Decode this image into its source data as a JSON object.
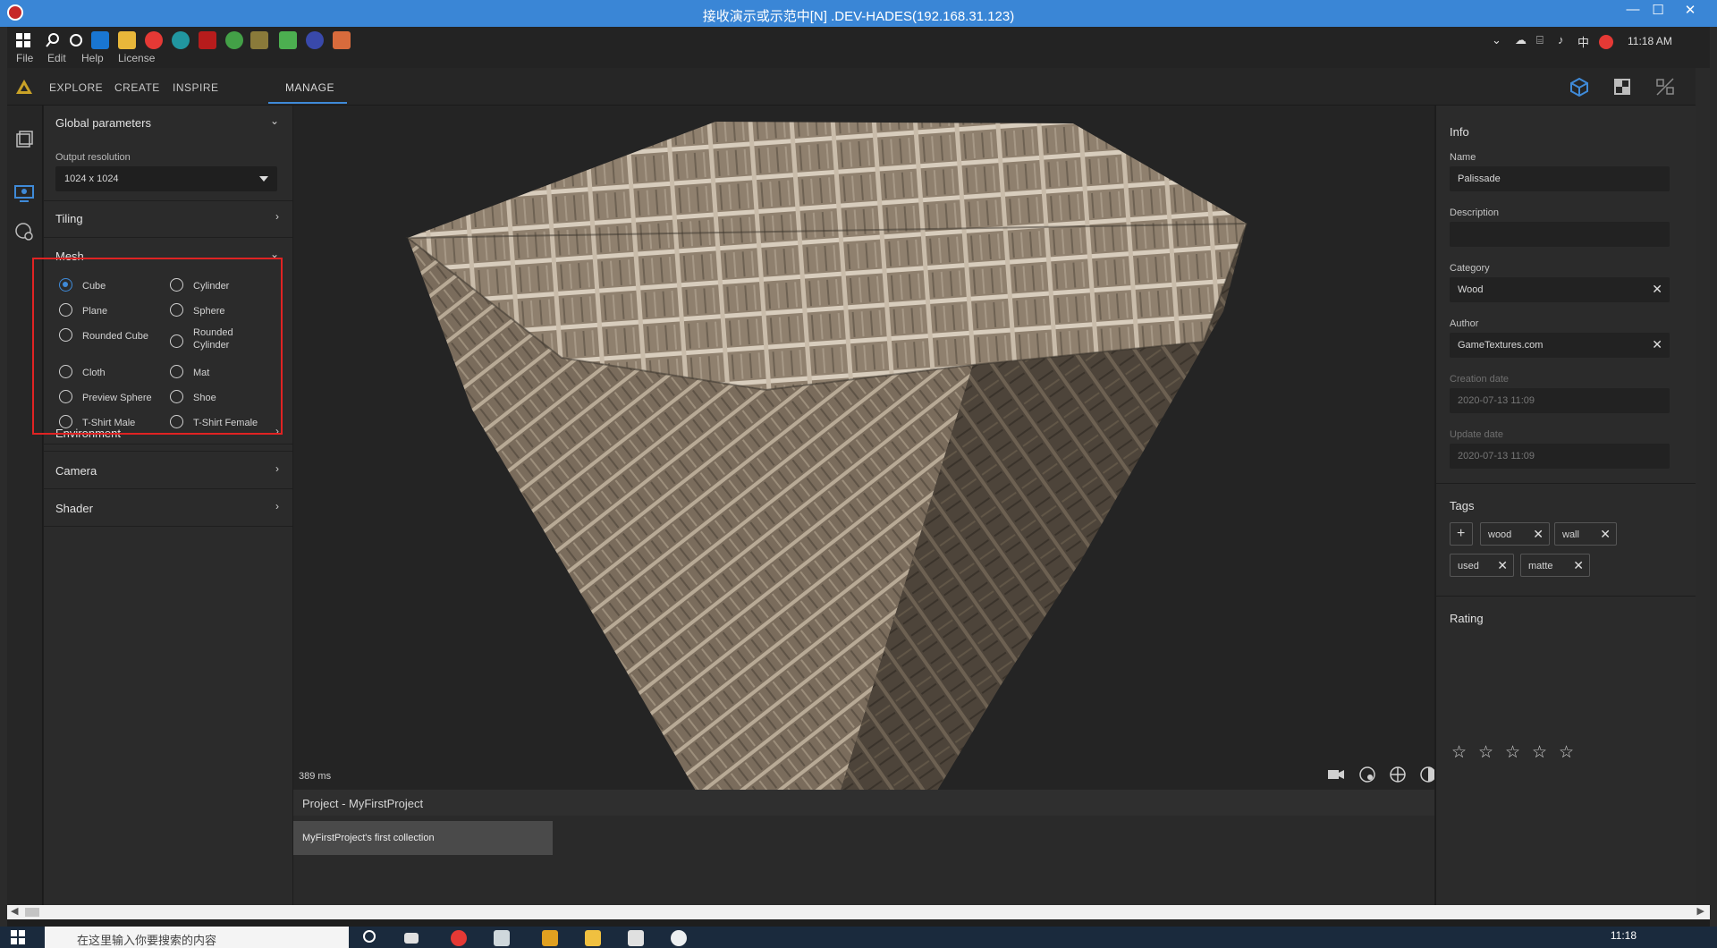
{
  "window": {
    "title": "接收演示或示范中[N] .DEV-HADES(192.168.31.123)"
  },
  "remote_menu": [
    "File",
    "Edit",
    "Help",
    "License"
  ],
  "tray": {
    "ime": "中",
    "clock": "11:18 AM"
  },
  "nav": {
    "tabs": [
      "EXPLORE",
      "CREATE",
      "INSPIRE",
      "MANAGE"
    ],
    "active": "MANAGE"
  },
  "left_panel": {
    "global": {
      "title": "Global parameters",
      "output_label": "Output resolution",
      "output_value": "1024 x 1024"
    },
    "tiling": "Tiling",
    "mesh": {
      "title": "Mesh",
      "selected": "Cube",
      "options": [
        "Cube",
        "Cylinder",
        "Plane",
        "Sphere",
        "Rounded Cube",
        "Rounded Cylinder",
        "Cloth",
        "Mat",
        "Preview Sphere",
        "Shoe",
        "T-Shirt Male",
        "T-Shirt Female"
      ]
    },
    "environment": "Environment",
    "camera": "Camera",
    "shader": "Shader"
  },
  "viewport": {
    "render_time": "389 ms"
  },
  "project": {
    "title": "Project - MyFirstProject",
    "collection": "MyFirstProject's first collection"
  },
  "info": {
    "title": "Info",
    "name_label": "Name",
    "name": "Palissade",
    "description_label": "Description",
    "description": "",
    "category_label": "Category",
    "category": "Wood",
    "author_label": "Author",
    "author": "GameTextures.com",
    "creation_label": "Creation date",
    "creation": "2020-07-13 11:09",
    "update_label": "Update date",
    "update": "2020-07-13 11:09"
  },
  "tags": {
    "title": "Tags",
    "add": "+",
    "items": [
      "wood",
      "wall",
      "used",
      "matte"
    ]
  },
  "rating": {
    "title": "Rating",
    "stars": 0,
    "max": 5
  },
  "taskbar": {
    "search_placeholder": "在这里输入你要搜索的内容",
    "clock": "11:18"
  },
  "colors": {
    "accent": "#3f8ad8",
    "highlight": "#e02323",
    "titlebar": "#3a86d6"
  }
}
